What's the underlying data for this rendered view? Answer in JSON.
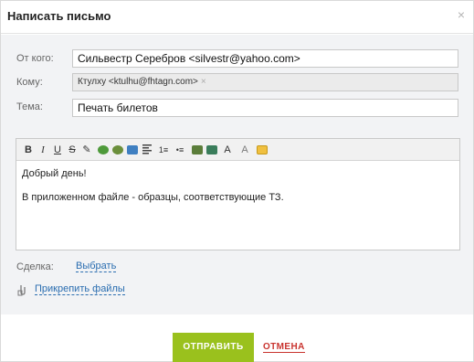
{
  "dialog": {
    "title": "Написать письмо",
    "close_glyph": "×"
  },
  "form": {
    "from_label": "От кого:",
    "from_value": "Сильвестр Серебров <silvestr@yahoo.com>",
    "to_label": "Кому:",
    "to_token": "Ктулху <ktulhu@fhtagn.com>",
    "to_token_remove": "×",
    "subject_label": "Тема:",
    "subject_value": "Печать билетов"
  },
  "editor": {
    "toolbar": {
      "bold": "B",
      "italic": "I",
      "underline": "U",
      "strike": "S",
      "eraser": "✎",
      "ordered_list": "1≡",
      "bullet_list": "•≡",
      "font_size": "A",
      "font_color": "A"
    },
    "paragraphs": [
      "Добрый день!",
      "В приложенном файле - образцы, соответствующие ТЗ."
    ]
  },
  "deal": {
    "label": "Сделка:",
    "link": "Выбрать"
  },
  "attach": {
    "icon": "📎",
    "link": "Прикрепить файлы"
  },
  "actions": {
    "send": "ОТПРАВИТЬ",
    "cancel": "ОТМЕНА"
  },
  "colors": {
    "send_button": "#9ac11d",
    "cancel_text": "#c9342f",
    "link": "#2a6db0"
  }
}
